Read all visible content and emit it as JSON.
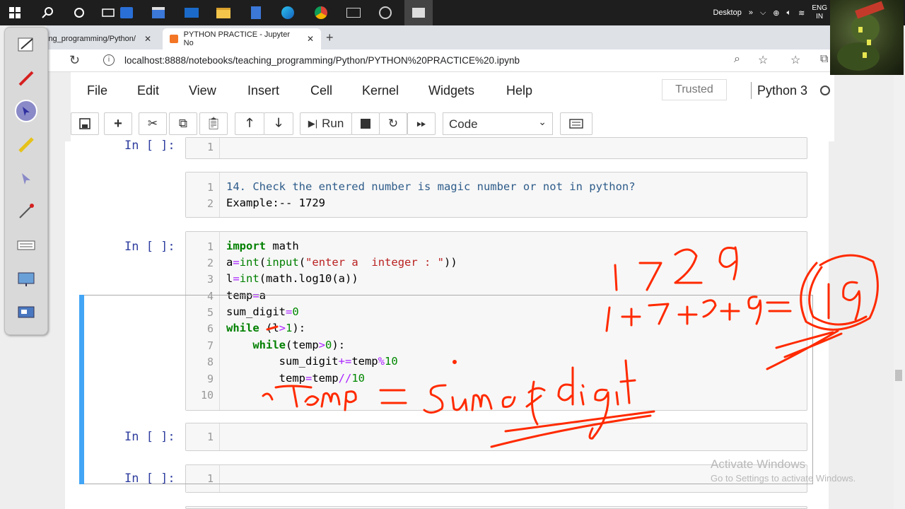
{
  "taskbar": {
    "desktop_label": "Desktop",
    "lang_line1": "ENG",
    "lang_line2": "IN"
  },
  "browser": {
    "tabs": [
      {
        "label": "ing_programming/Python/",
        "close": "✕"
      },
      {
        "label": "PYTHON PRACTICE - Jupyter No",
        "close": "✕"
      }
    ],
    "new_tab": "+",
    "url": "localhost:8888/notebooks/teaching_programming/Python/PYTHON%20PRACTICE%20.ipynb"
  },
  "jupyter": {
    "menu": [
      "File",
      "Edit",
      "View",
      "Insert",
      "Cell",
      "Kernel",
      "Widgets",
      "Help"
    ],
    "trusted": "Trusted",
    "kernel": "Python 3",
    "toolbar": {
      "run_label": "Run",
      "cell_type": "Code"
    },
    "cells": [
      {
        "prompt": "In [ ]:",
        "lines": [
          "1"
        ]
      },
      {
        "markdown": [
          "14. Check the entered number is magic number or not in python?",
          "Example:-- 1729"
        ],
        "lines": [
          "1",
          "2"
        ]
      },
      {
        "prompt": "In [ ]:",
        "lines": [
          "1",
          "2",
          "3",
          "4",
          "5",
          "6",
          "7",
          "8",
          "9",
          "10"
        ]
      },
      {
        "prompt": "In [ ]:",
        "lines": [
          "1"
        ]
      },
      {
        "prompt": "In [ ]:",
        "lines": [
          "1"
        ]
      }
    ]
  },
  "watermark": {
    "line1": "Activate Windows",
    "line2": "Go to Settings to activate Windows."
  },
  "annotations": {
    "n1": "1729",
    "sum": "1+7+2+9=",
    "result": "19",
    "eq": "temp = sum of digit"
  },
  "colors": {
    "ink": "#ff2a00",
    "prompt": "#303f9f",
    "selected_cell": "#42a5f5"
  }
}
